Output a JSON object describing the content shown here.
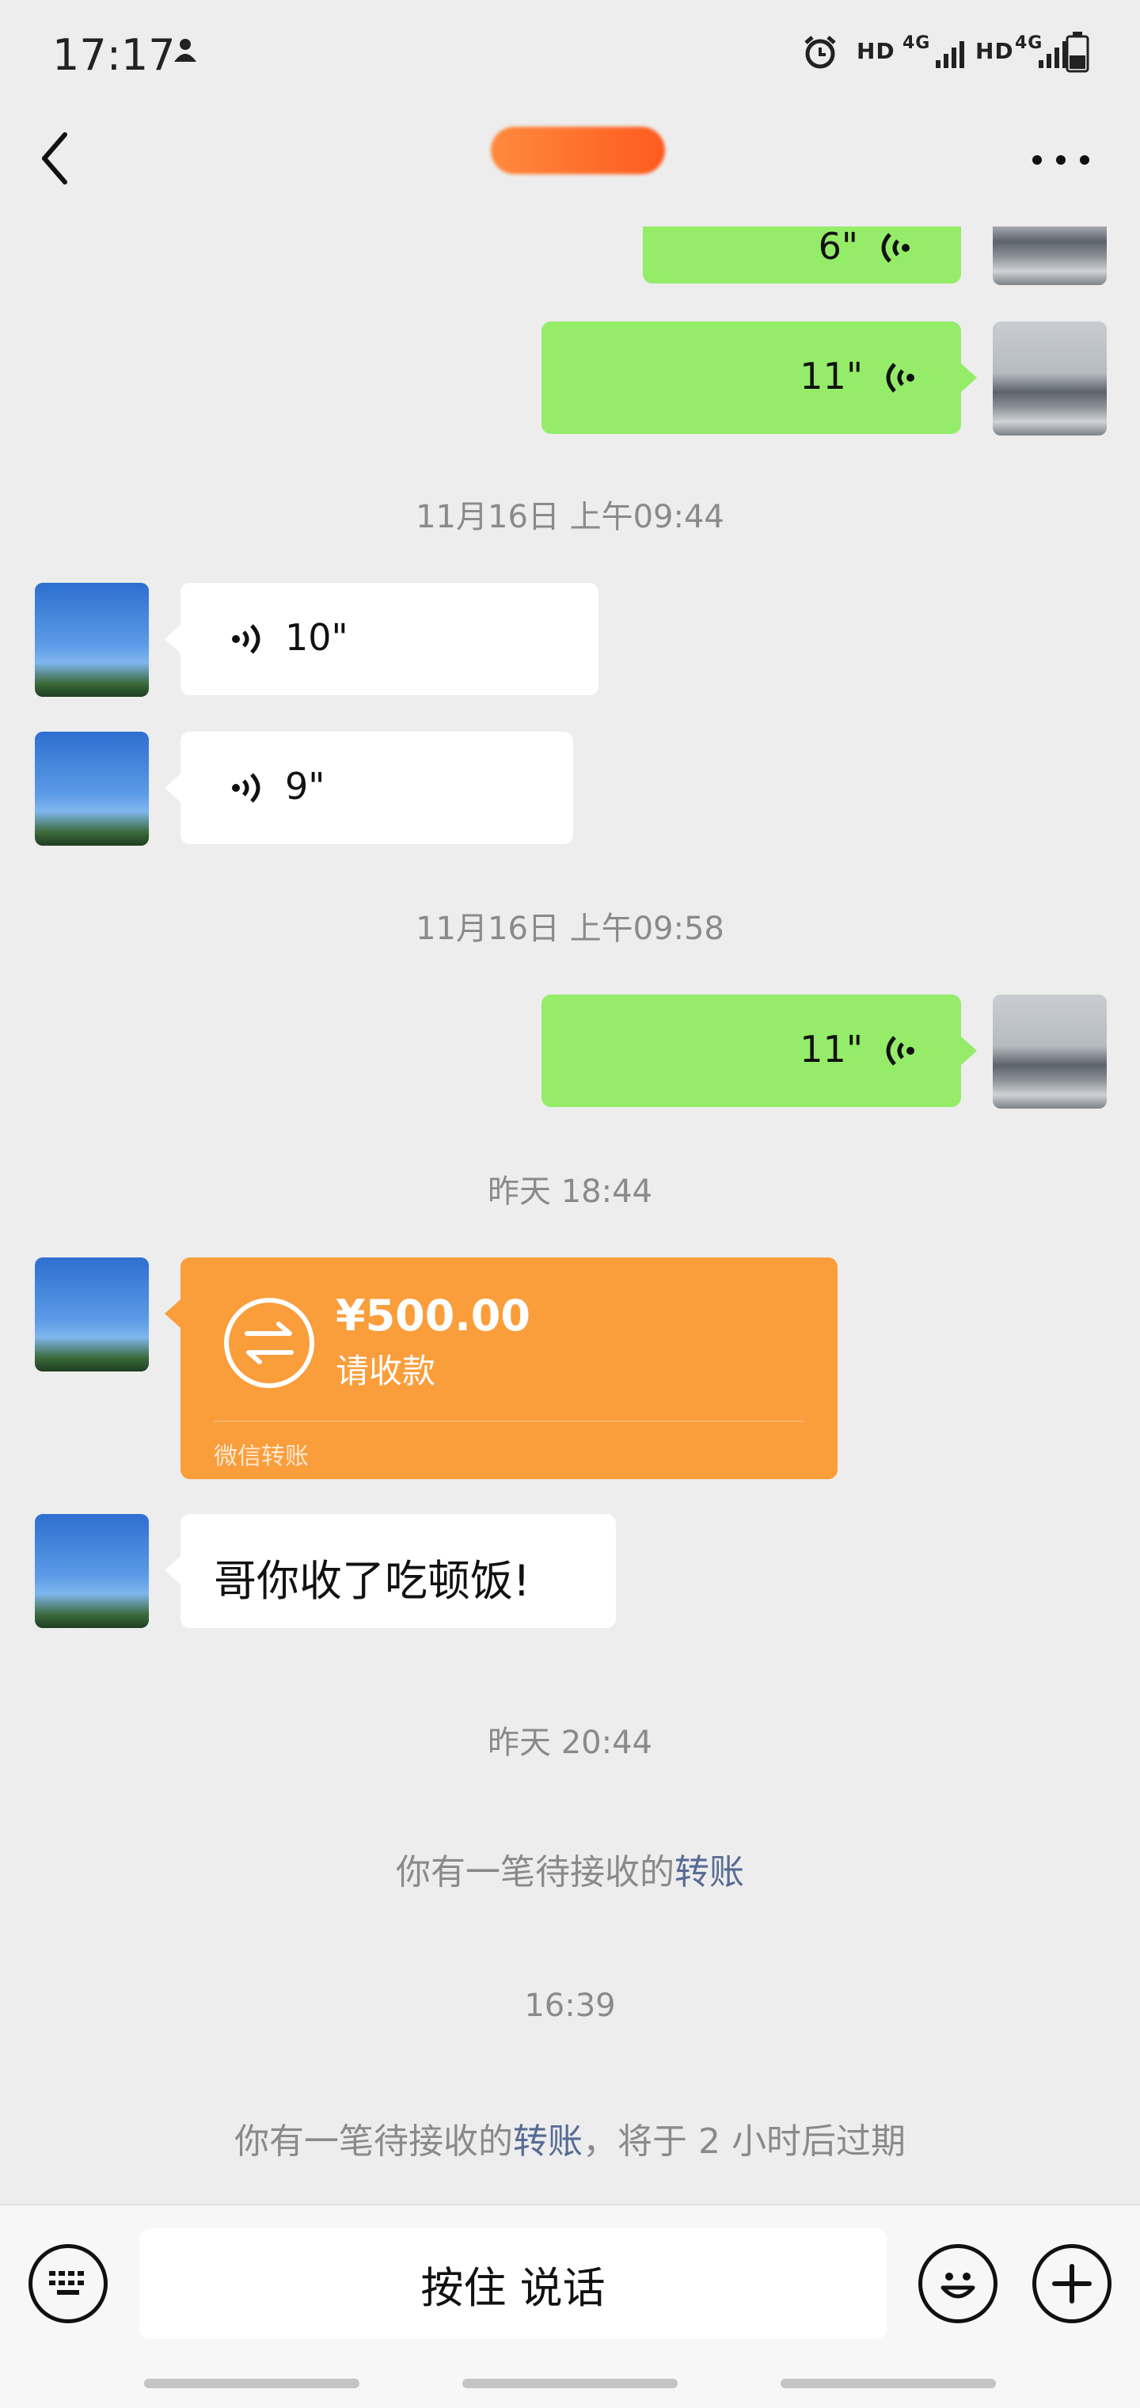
{
  "status_bar": {
    "time": "17:17",
    "network_1": "HD",
    "network_2": "HD",
    "signal_1": "4G",
    "signal_2": "4G"
  },
  "nav": {
    "title": ""
  },
  "messages": {
    "m1_voice": "6\"",
    "m2_voice": "11\"",
    "ts1": "11月16日 上午09:44",
    "m3_voice": "10\"",
    "m4_voice": "9\"",
    "ts2": "11月16日 上午09:58",
    "m5_voice": "11\"",
    "ts3": "昨天 18:44",
    "transfer": {
      "amount": "¥500.00",
      "status": "请收款",
      "footer": "微信转账"
    },
    "m7_text": "哥你收了吃顿饭!",
    "ts4": "昨天 20:44",
    "sys1_prefix": "你有一笔待接收的",
    "sys1_link": "转账",
    "ts5": "16:39",
    "sys2_prefix": "你有一笔待接收的",
    "sys2_link": "转账",
    "sys2_suffix": "，将于 2 小时后过期"
  },
  "input_bar": {
    "hold_to_talk": "按住 说话"
  },
  "colors": {
    "self_bubble": "#95ec69",
    "other_bubble": "#ffffff",
    "transfer_card": "#fa9d3b",
    "link": "#576b95",
    "background": "#ededed"
  }
}
